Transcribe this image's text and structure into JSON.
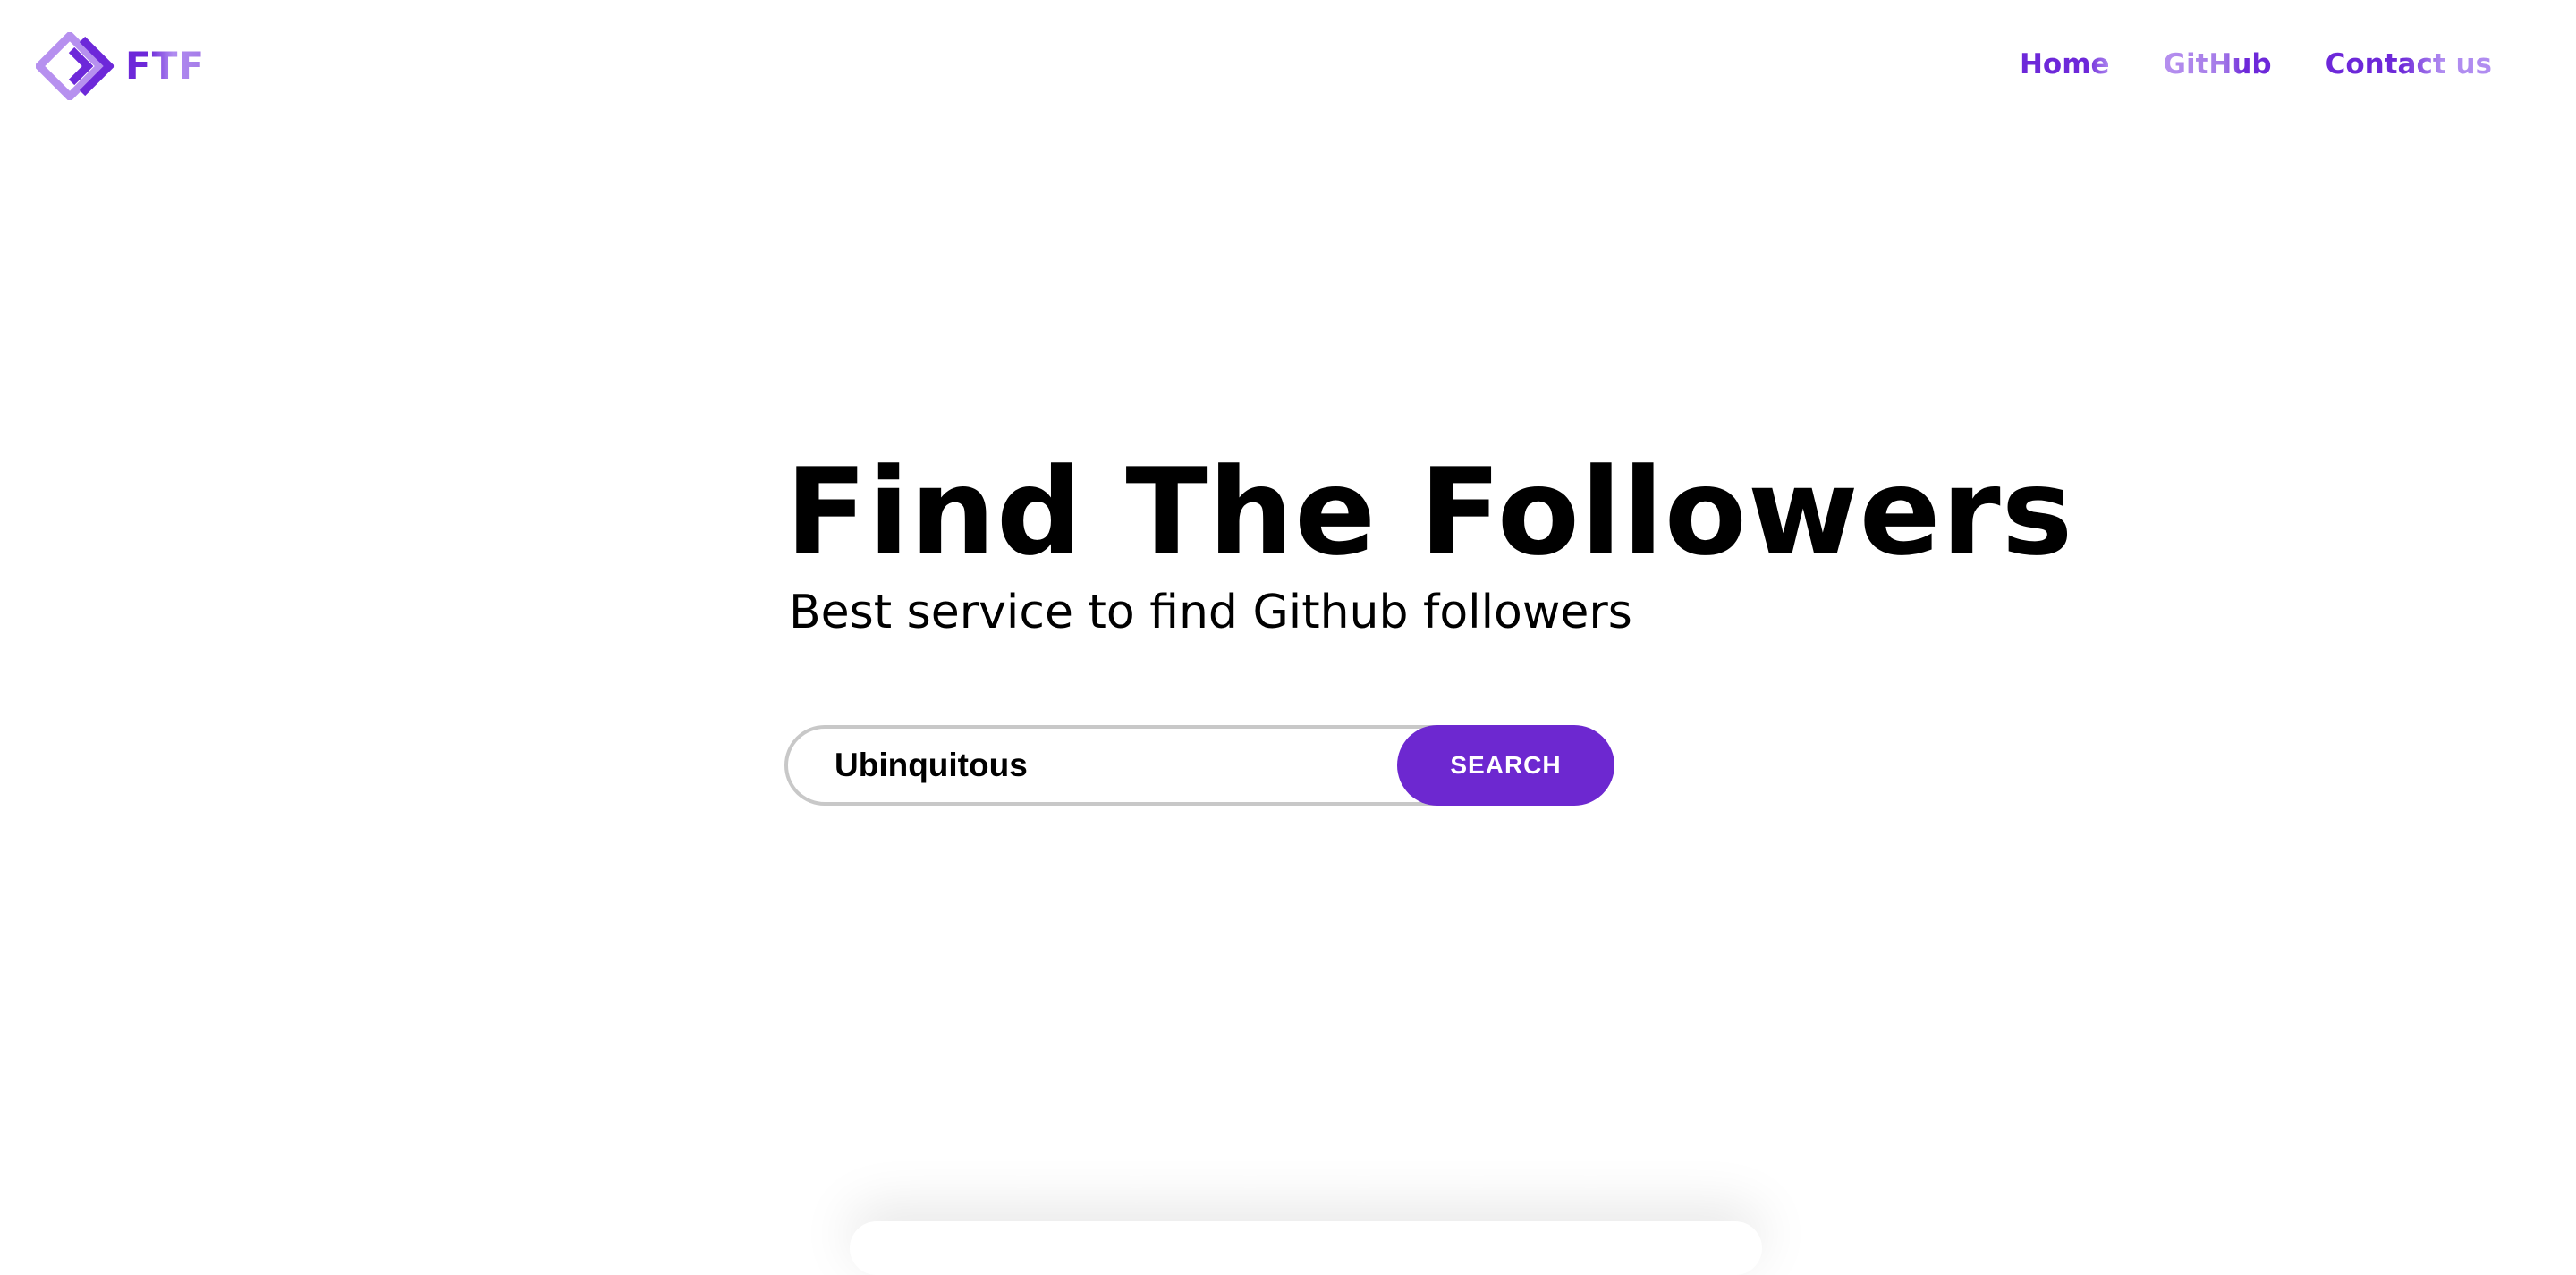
{
  "header": {
    "logo_text": "FTF",
    "logo_icon": "double-diamond-logo-icon",
    "nav": [
      {
        "label": "Home"
      },
      {
        "label": "GitHub"
      },
      {
        "label": "Contact us"
      }
    ]
  },
  "hero": {
    "title": "Find The Followers",
    "subtitle": "Best service to find Github followers"
  },
  "search": {
    "value": "Ubinquitous",
    "button_label": "SEARCH"
  },
  "colors": {
    "brand_purple": "#6d28d9",
    "brand_light_purple": "#b08cf0",
    "button_bg": "#6d28d0",
    "input_border": "#c8c8c8"
  }
}
